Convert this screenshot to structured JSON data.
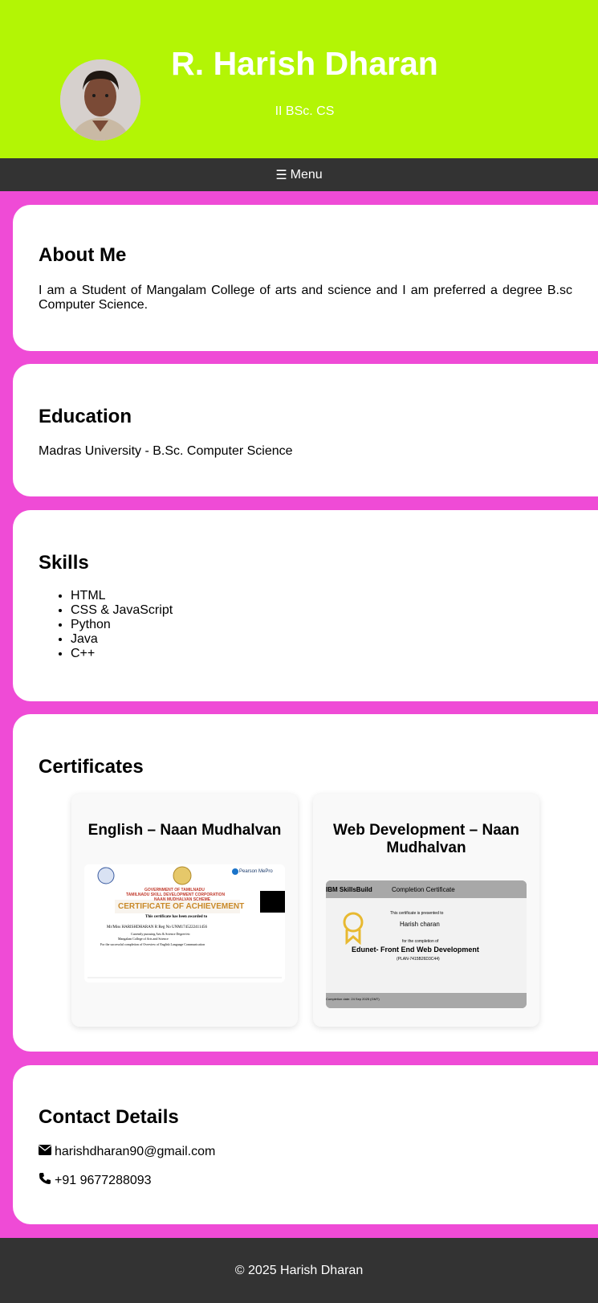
{
  "header": {
    "name": "R. Harish Dharan",
    "subtitle": "II BSc. CS",
    "bg_color": "#b3f505"
  },
  "nav": {
    "menu_icon": "☰",
    "menu_label": "Menu"
  },
  "about": {
    "title": "About Me",
    "text": "I am a Student of Mangalam College of arts and science and I am preferred a degree B.sc Computer Science."
  },
  "education": {
    "title": "Education",
    "text": "Madras University - B.Sc. Computer Science"
  },
  "skills": {
    "title": "Skills",
    "items": [
      "HTML",
      "CSS & JavaScript",
      "Python",
      "Java",
      "C++"
    ]
  },
  "certificates": {
    "title": "Certificates",
    "items": [
      {
        "title": "English – Naan Mudhalvan",
        "image": {
          "gov_line1": "GOVERNMENT OF TAMILNADU",
          "gov_line2": "TAMILNADU SKILL DEVELOPMENT CORPORATION",
          "gov_line3": "NAAN MUDHALVAN SCHEME",
          "heading": "CERTIFICATE OF ACHIEVEMENT",
          "awarded": "This certificate has been awarded to",
          "name_line": "Mr/Miss   HARISHDHARAN R          Reg No   UNM1745222411456",
          "pursuing": "Currently pursuing   Arts & Science Degree/etc",
          "college": "Mangalam College of Arts and Science",
          "course": "For the successful completion of   Overview of English Language Communication",
          "partner": "Pearson MePro"
        }
      },
      {
        "title": "Web Development – Naan Mudhalvan",
        "image": {
          "brand": "IBM SkillsBuild",
          "label": "Completion Certificate",
          "presented": "This certificate is presented to",
          "name": "Harish charan",
          "completion": "for the completion of",
          "course": "Edunet- Front End Web Development",
          "code": "(PLAN-7415B26D3C44)",
          "footer": "Completion date: 24 Sep 2025 (GMT)"
        }
      }
    ]
  },
  "contact": {
    "title": "Contact Details",
    "email": "harishdharan90@gmail.com",
    "phone": "+91 9677288093"
  },
  "footer": {
    "text": "© 2025 Harish Dharan"
  },
  "colors": {
    "page_bg": "#ef4bd6",
    "nav_bg": "#333333",
    "card_bg": "#ffffff"
  }
}
